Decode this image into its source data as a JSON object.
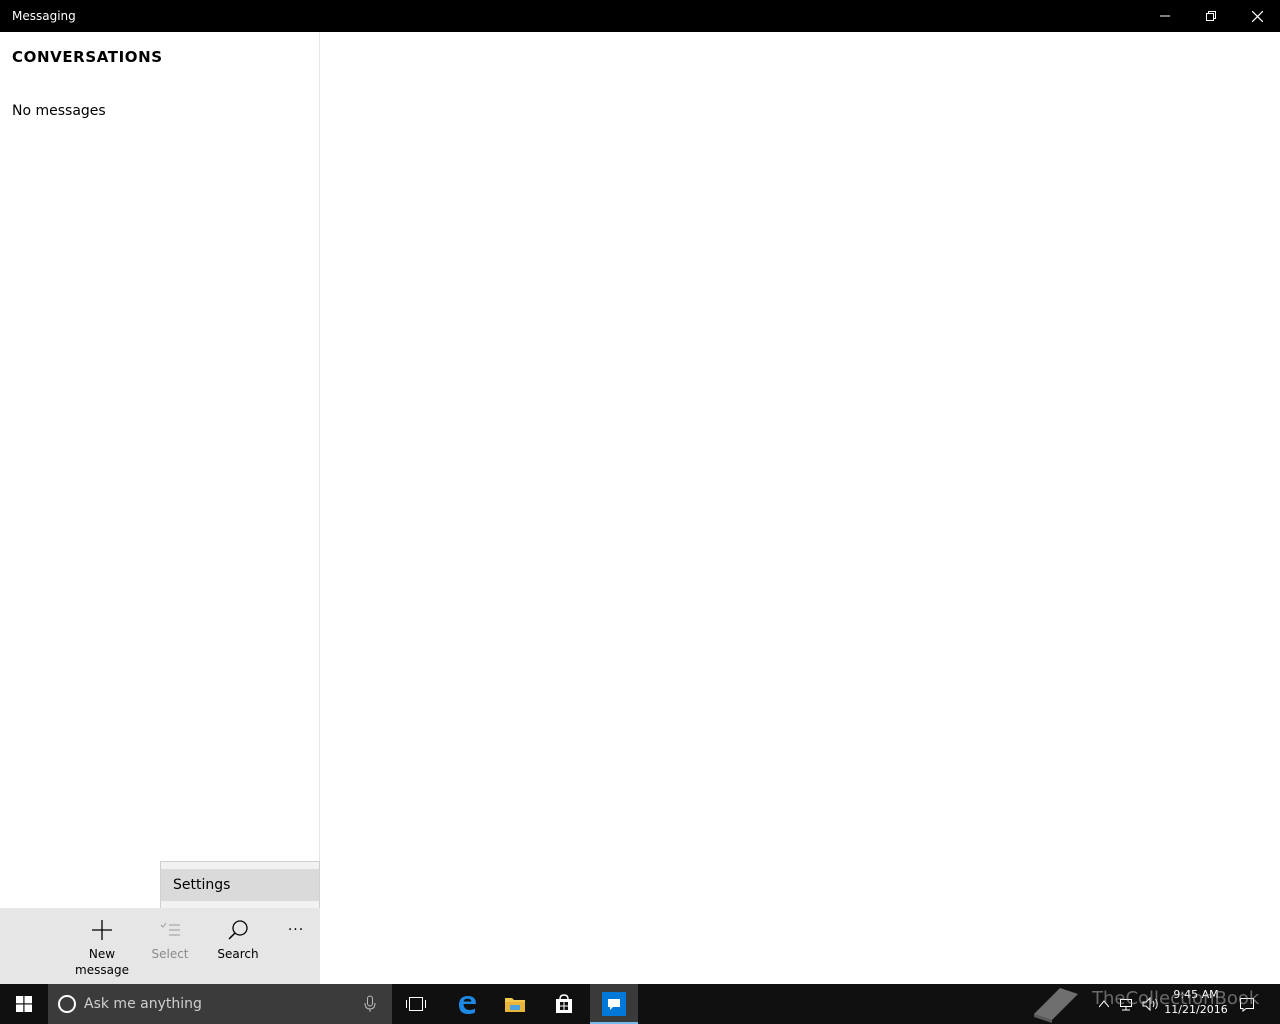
{
  "window": {
    "title": "Messaging",
    "controls": [
      "minimize-icon",
      "restore-icon",
      "close-icon"
    ]
  },
  "conversations": {
    "heading": "CONVERSATIONS",
    "empty_text": "No messages"
  },
  "flyout": {
    "items": [
      {
        "label": "Settings"
      }
    ]
  },
  "commandbar": {
    "new_message": {
      "label_line1": "New",
      "label_line2": "message",
      "icon": "plus-icon"
    },
    "select": {
      "label": "Select",
      "icon": "multi-select-icon",
      "enabled": false
    },
    "search": {
      "label": "Search",
      "icon": "search-icon"
    },
    "more": {
      "label": "···",
      "icon": "more-icon"
    }
  },
  "taskbar": {
    "search_placeholder": "Ask me anything",
    "pinned": [
      "task-view-icon",
      "edge-icon",
      "file-explorer-icon",
      "store-icon",
      "messaging-icon"
    ],
    "active_app": "messaging-icon",
    "clock_time": "9:45 AM",
    "clock_date": "11/21/2016"
  },
  "watermark": {
    "text": "TheCollectionBook"
  },
  "colors": {
    "titlebar": "#000000",
    "commandbar": "#e6e6e6",
    "flyout_highlight": "#dadada",
    "taskbar": "#101010",
    "search_box": "#3b3b3b",
    "accent": "#0078d7"
  }
}
